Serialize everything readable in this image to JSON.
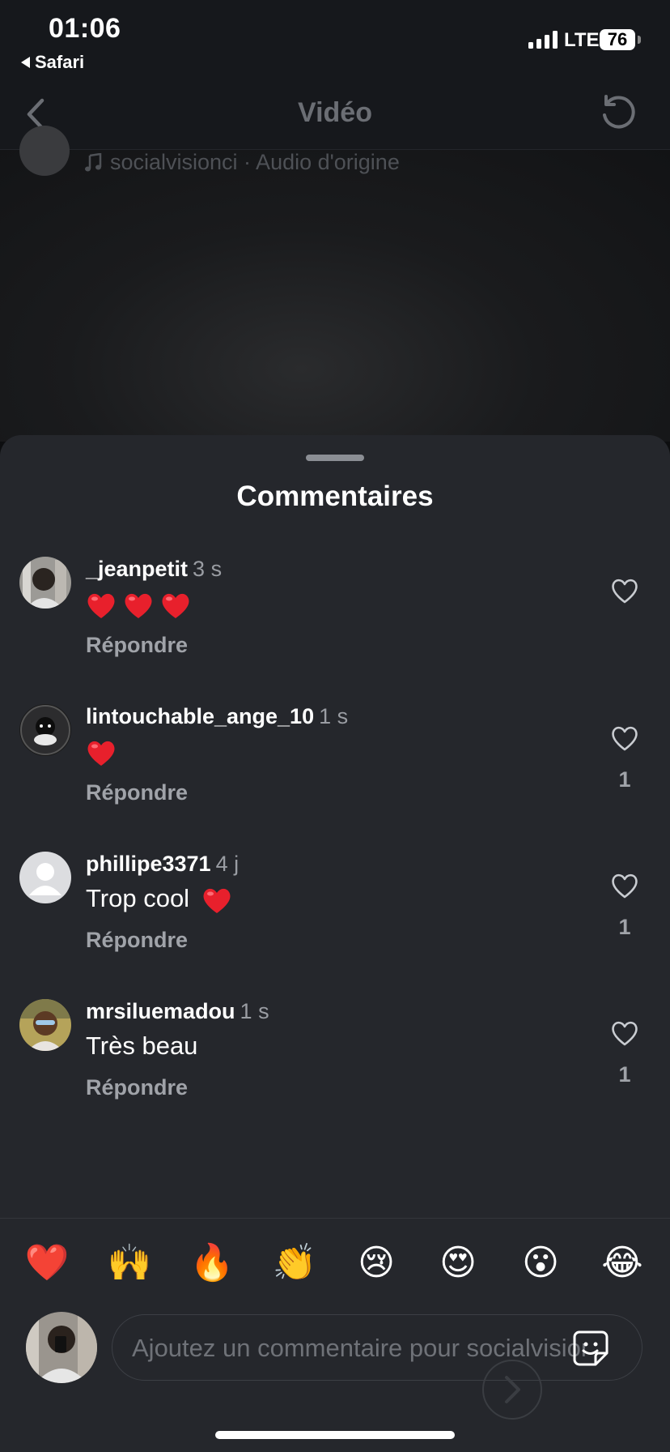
{
  "status": {
    "time": "01:06",
    "back_app": "Safari",
    "network": "LTE",
    "battery": "76"
  },
  "header": {
    "title": "Vidéo"
  },
  "video": {
    "audio": "socialvisionci · Audio d'origine"
  },
  "sheet": {
    "title": "Commentaires"
  },
  "comments": [
    {
      "user": "_jeanpetit",
      "ago": "3 s",
      "text": "",
      "hearts": 3,
      "reply": "Répondre",
      "likes": ""
    },
    {
      "user": "lintouchable_ange_10",
      "ago": "1 s",
      "text": "",
      "hearts": 1,
      "reply": "Répondre",
      "likes": "1"
    },
    {
      "user": "phillipe3371",
      "ago": "4 j",
      "text": "Trop cool",
      "hearts": 1,
      "reply": "Répondre",
      "likes": "1"
    },
    {
      "user": "mrsiluemadou",
      "ago": "1 s",
      "text": "Très beau",
      "hearts": 0,
      "reply": "Répondre",
      "likes": "1"
    }
  ],
  "reactions": [
    "❤️",
    "🙌",
    "🔥",
    "👏",
    "😢",
    "😍",
    "😮",
    "😂"
  ],
  "composer": {
    "placeholder": "Ajoutez un commentaire pour socialvisionci..."
  },
  "colors": {
    "sheet": "#25272c",
    "heart_red": "#e8202c",
    "muted": "#a0a3a9"
  }
}
